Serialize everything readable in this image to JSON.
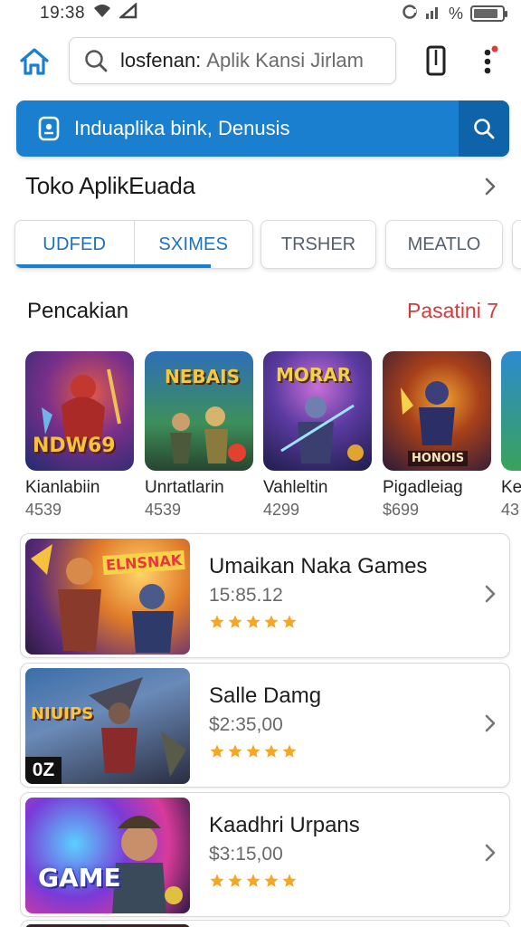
{
  "status_bar": {
    "time": "19:38",
    "battery_text": "%",
    "battery_level": 0.85
  },
  "top_bar": {
    "search_typed": "losfenan:",
    "search_placeholder": "Aplik Kansi Jirlam"
  },
  "banner": {
    "text": "Induaplika bink, Denusis"
  },
  "section": {
    "title": "Toko AplikEuada"
  },
  "tabs": [
    {
      "label": "UDFED",
      "active": true
    },
    {
      "label": "SXIMES",
      "active": false
    },
    {
      "label": "TRSHER",
      "active": false
    },
    {
      "label": "MEATLO",
      "active": false
    }
  ],
  "recommend": {
    "title": "Pencakian",
    "link": "Pasatini 7",
    "items": [
      {
        "name": "Kianlabiin",
        "price": "4539",
        "art_text": "NDW69"
      },
      {
        "name": "Unrtatlarin",
        "price": "4539",
        "art_text": "NEBAIS"
      },
      {
        "name": "Vahleltin",
        "price": "4299",
        "art_text": "MORAR"
      },
      {
        "name": "Pigadleiag",
        "price": "$699",
        "art_text": "HONOIS"
      },
      {
        "name": "Ke",
        "price": "43",
        "art_text": ""
      }
    ]
  },
  "list": [
    {
      "title": "Umaikan Naka Games",
      "price": "15:85.12",
      "rating": 5,
      "art_text": "ELNSNAK"
    },
    {
      "title": "Salle Damg",
      "price": "$2:35,00",
      "rating": 5,
      "art_text": "NIUIPS",
      "badge": "0Z"
    },
    {
      "title": "Kaadhri Urpans",
      "price": "$3:15,00",
      "rating": 5,
      "art_text": "GAME"
    }
  ],
  "colors": {
    "accent": "#1b7fcf",
    "link_red": "#d43a3a",
    "star": "#f5a623"
  },
  "icons": [
    "home-icon",
    "search-icon",
    "phone-icon",
    "more-vert-icon",
    "lock-icon",
    "chevron-right-icon",
    "star-icon",
    "wifi-icon",
    "signal-icon",
    "battery-icon"
  ]
}
